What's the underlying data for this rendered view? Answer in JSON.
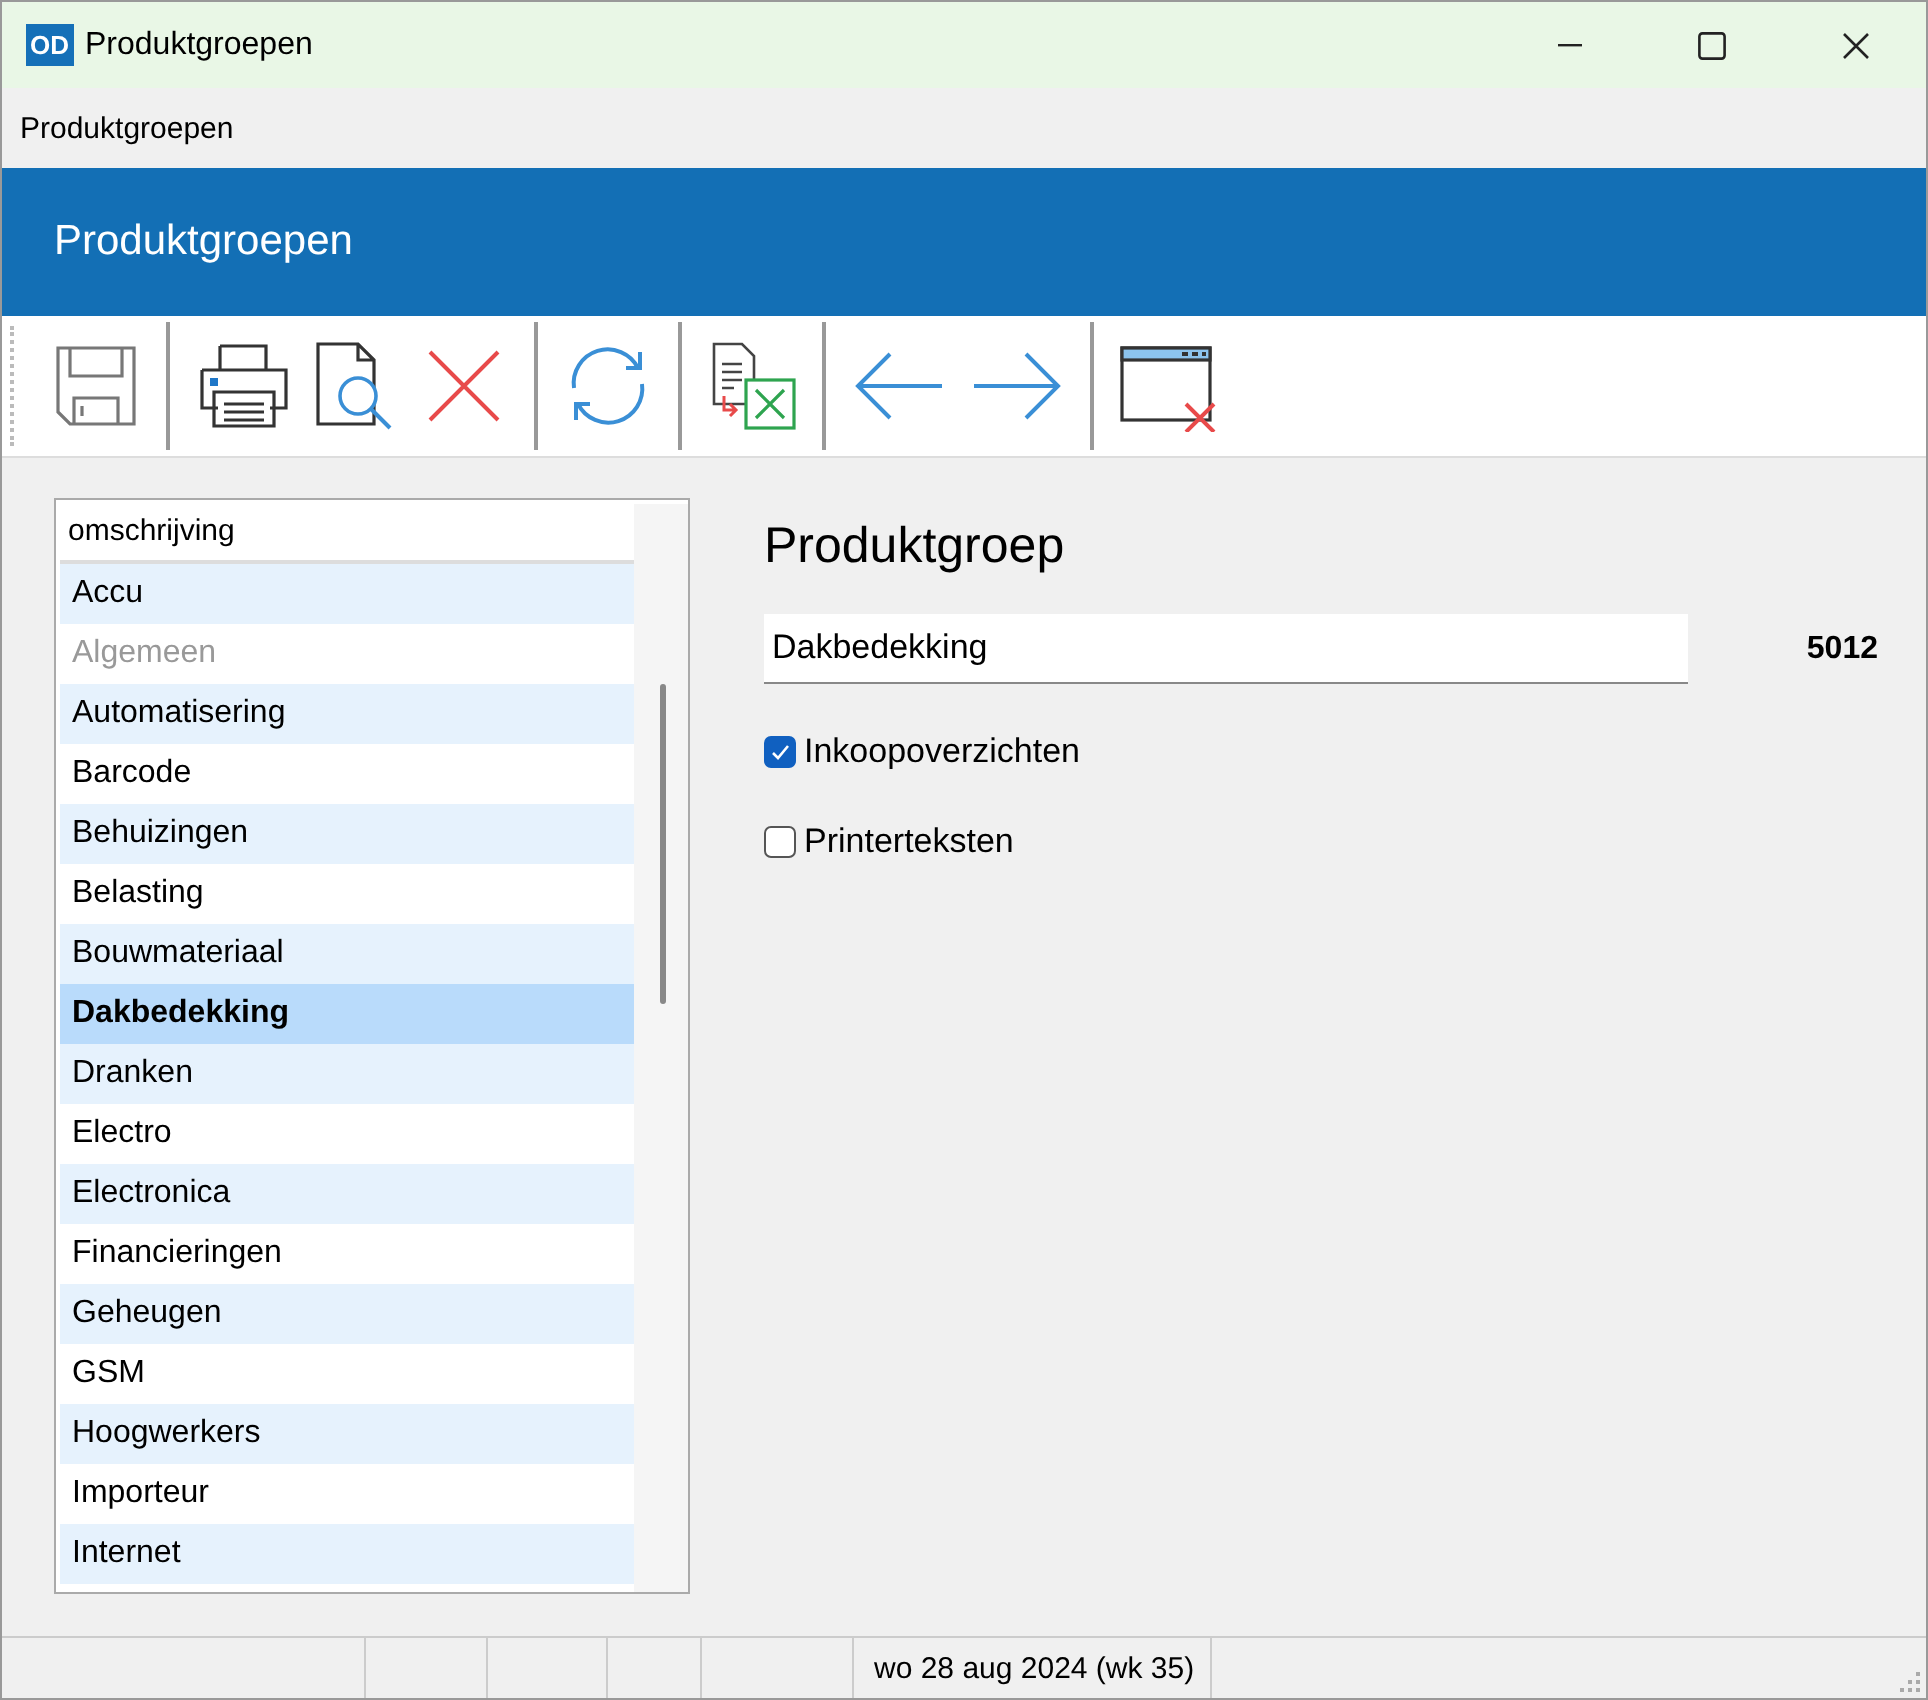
{
  "window": {
    "title": "Produktgroepen",
    "app_badge": "OD"
  },
  "menu": [
    "Produktgroepen"
  ],
  "header": {
    "title": "Produktgroepen"
  },
  "list": {
    "column": "omschrijving",
    "items": [
      {
        "label": "Accu",
        "selected": false,
        "disabled": false
      },
      {
        "label": "Algemeen",
        "selected": false,
        "disabled": true
      },
      {
        "label": "Automatisering",
        "selected": false,
        "disabled": false
      },
      {
        "label": "Barcode",
        "selected": false,
        "disabled": false
      },
      {
        "label": "Behuizingen",
        "selected": false,
        "disabled": false
      },
      {
        "label": "Belasting",
        "selected": false,
        "disabled": false
      },
      {
        "label": "Bouwmateriaal",
        "selected": false,
        "disabled": false
      },
      {
        "label": "Dakbedekking",
        "selected": true,
        "disabled": false
      },
      {
        "label": "Dranken",
        "selected": false,
        "disabled": false
      },
      {
        "label": "Electro",
        "selected": false,
        "disabled": false
      },
      {
        "label": "Electronica",
        "selected": false,
        "disabled": false
      },
      {
        "label": "Financieringen",
        "selected": false,
        "disabled": false
      },
      {
        "label": "Geheugen",
        "selected": false,
        "disabled": false
      },
      {
        "label": "GSM",
        "selected": false,
        "disabled": false
      },
      {
        "label": "Hoogwerkers",
        "selected": false,
        "disabled": false
      },
      {
        "label": "Importeur",
        "selected": false,
        "disabled": false
      },
      {
        "label": "Internet",
        "selected": false,
        "disabled": false
      }
    ]
  },
  "detail": {
    "title": "Produktgroep",
    "name": "Dakbedekking",
    "code": "5012",
    "checkboxes": [
      {
        "label": "Inkoopoverzichten",
        "checked": true
      },
      {
        "label": "Printerteksten",
        "checked": false
      }
    ]
  },
  "status_bar": {
    "date": "wo 28 aug 2024 (wk 35)"
  }
}
